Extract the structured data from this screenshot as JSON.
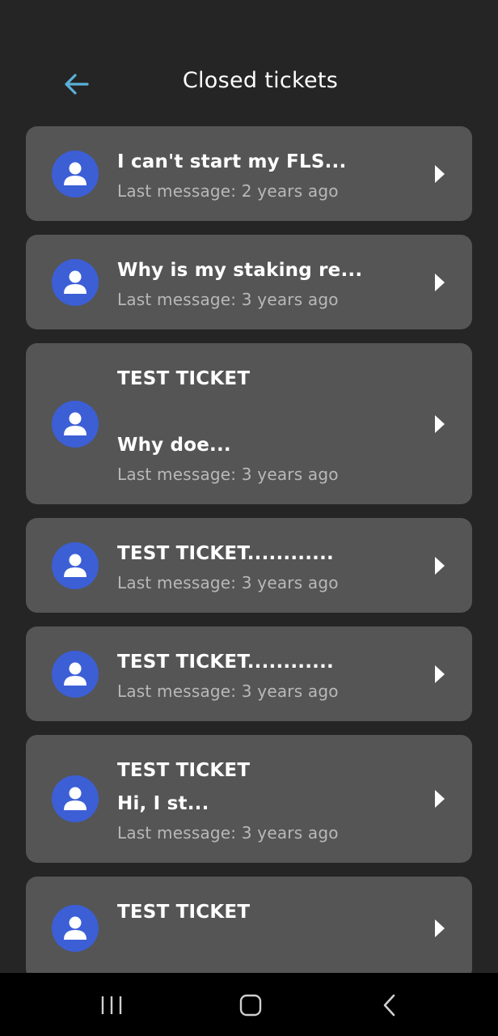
{
  "header": {
    "title": "Closed tickets",
    "back_icon": "arrow-left-icon",
    "accent_color": "#5ab0d8"
  },
  "tickets": [
    {
      "subject": "I can't start my FLS...",
      "last_message": "Last message: 2 years ago"
    },
    {
      "subject": "Why is my staking re...",
      "last_message": "Last message: 3 years ago"
    },
    {
      "subject": "TEST TICKET\n\nWhy doe...",
      "last_message": "Last message: 3 years ago"
    },
    {
      "subject": "TEST TICKET............",
      "last_message": "Last message: 3 years ago"
    },
    {
      "subject": "TEST TICKET............",
      "last_message": "Last message: 3 years ago"
    },
    {
      "subject": "TEST TICKET\nHi, I st...",
      "last_message": "Last message: 3 years ago"
    },
    {
      "subject": "TEST TICKET\n\n",
      "last_message": ""
    }
  ],
  "colors": {
    "background": "#252525",
    "card": "#555555",
    "avatar": "#3c5fd6",
    "meta_text": "#b8b8b8"
  },
  "system_nav": {
    "recents_icon": "recents-icon",
    "home_icon": "home-icon",
    "back_icon": "back-chevron-icon"
  }
}
